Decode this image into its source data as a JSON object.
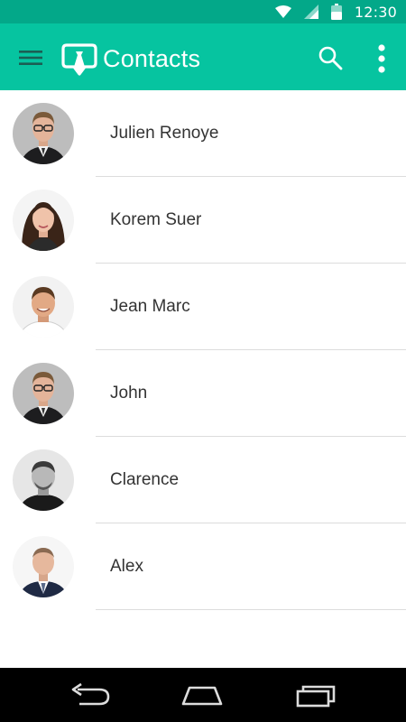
{
  "status_bar": {
    "time": "12:30",
    "icons": [
      "wifi-icon",
      "cell-signal-icon",
      "battery-icon"
    ]
  },
  "app_bar": {
    "title": "Contacts",
    "icons": [
      "menu-icon",
      "app-logo-icon",
      "search-icon",
      "more-vert-icon"
    ],
    "background_color": "#06c4a0"
  },
  "contacts": [
    {
      "name": "Julien Renoye"
    },
    {
      "name": "Korem Suer"
    },
    {
      "name": "Jean Marc"
    },
    {
      "name": "John"
    },
    {
      "name": "Clarence"
    },
    {
      "name": "Alex"
    }
  ],
  "nav_bar": {
    "icons": [
      "back-icon",
      "home-icon",
      "recents-icon"
    ]
  }
}
